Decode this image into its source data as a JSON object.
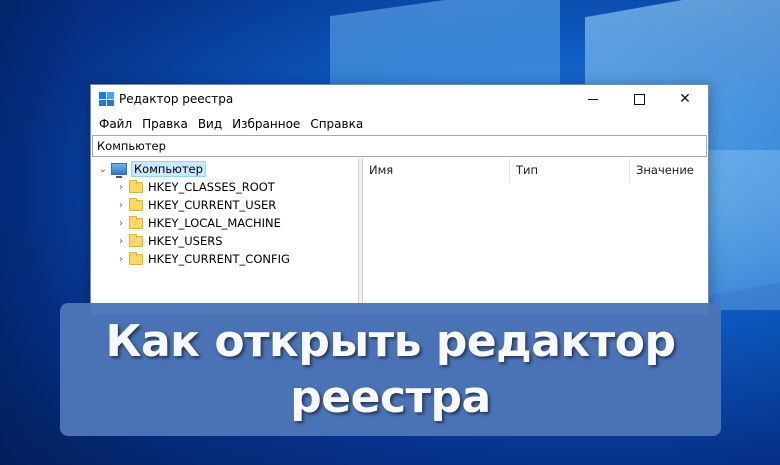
{
  "window": {
    "title": "Редактор реестра",
    "menu": [
      "Файл",
      "Правка",
      "Вид",
      "Избранное",
      "Справка"
    ],
    "address": "Компьютер",
    "close_glyph": "✕"
  },
  "tree": {
    "root": "Компьютер",
    "children": [
      "HKEY_CLASSES_ROOT",
      "HKEY_CURRENT_USER",
      "HKEY_LOCAL_MACHINE",
      "HKEY_USERS",
      "HKEY_CURRENT_CONFIG"
    ]
  },
  "list": {
    "columns": [
      "Имя",
      "Тип",
      "Значение"
    ]
  },
  "banner": {
    "line1": "Как открыть редактор",
    "line2": "реестра"
  },
  "colors": {
    "banner": "#4d75b8",
    "selection": "#cce8ff"
  }
}
